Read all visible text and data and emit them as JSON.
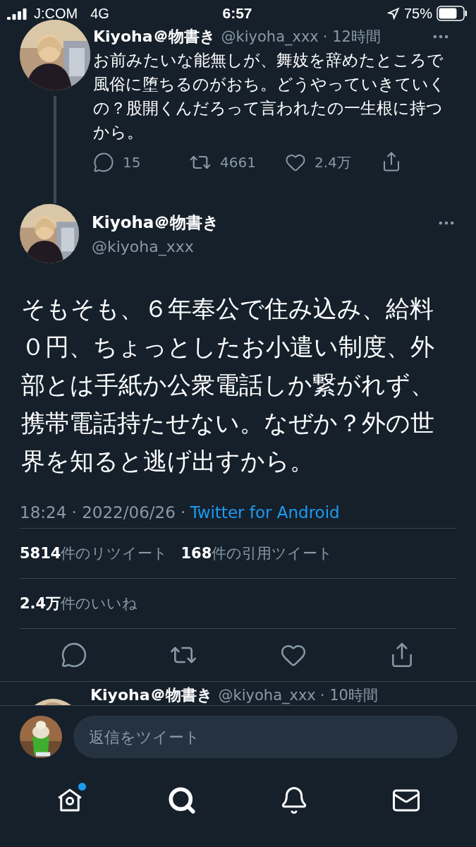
{
  "status_bar": {
    "carrier": "J:COM",
    "network": "4G",
    "time": "6:57",
    "battery": "75%"
  },
  "parent_tweet": {
    "name": "Kiyoha＠物書き",
    "handle": "@kiyoha_xxx",
    "time": "· 12時間",
    "text": "お前みたいな能無しが、舞妓を辞めたところで風俗に堕ちるのがおち。どうやっていきていくの？股開くんだろって言われたの一生根に持つから。",
    "reply_count": "15",
    "retweet_count": "4661",
    "like_count": "2.4万"
  },
  "main_tweet": {
    "name": "Kiyoha＠物書き",
    "handle": "@kiyoha_xxx",
    "text": "そもそも、６年奉公で住み込み、給料０円、ちょっとしたお小遣い制度、外部とは手紙か公衆電話しか繋がれず、携帯電話持たせない。なぜか？外の世界を知ると逃げ出すから。",
    "timestamp": "18:24 · 2022/06/26 ·",
    "source": "Twitter for Android",
    "stats": [
      {
        "count": "5814",
        "label": "件のリツイート"
      },
      {
        "count": "168",
        "label": "件の引用ツイート"
      }
    ],
    "likes": {
      "count": "2.4万",
      "label": "件のいいね"
    }
  },
  "next_tweet": {
    "name": "Kiyoha＠物書き",
    "handle": "@kiyoha_xxx",
    "time": "· 10時間"
  },
  "composer": {
    "placeholder": "返信をツイート"
  },
  "tab_bar": [
    {
      "kind": "home",
      "selected": false,
      "badge": true
    },
    {
      "kind": "search",
      "selected": true,
      "badge": false
    },
    {
      "kind": "notifications",
      "selected": false,
      "badge": false
    },
    {
      "kind": "messages",
      "selected": false,
      "badge": false
    }
  ]
}
